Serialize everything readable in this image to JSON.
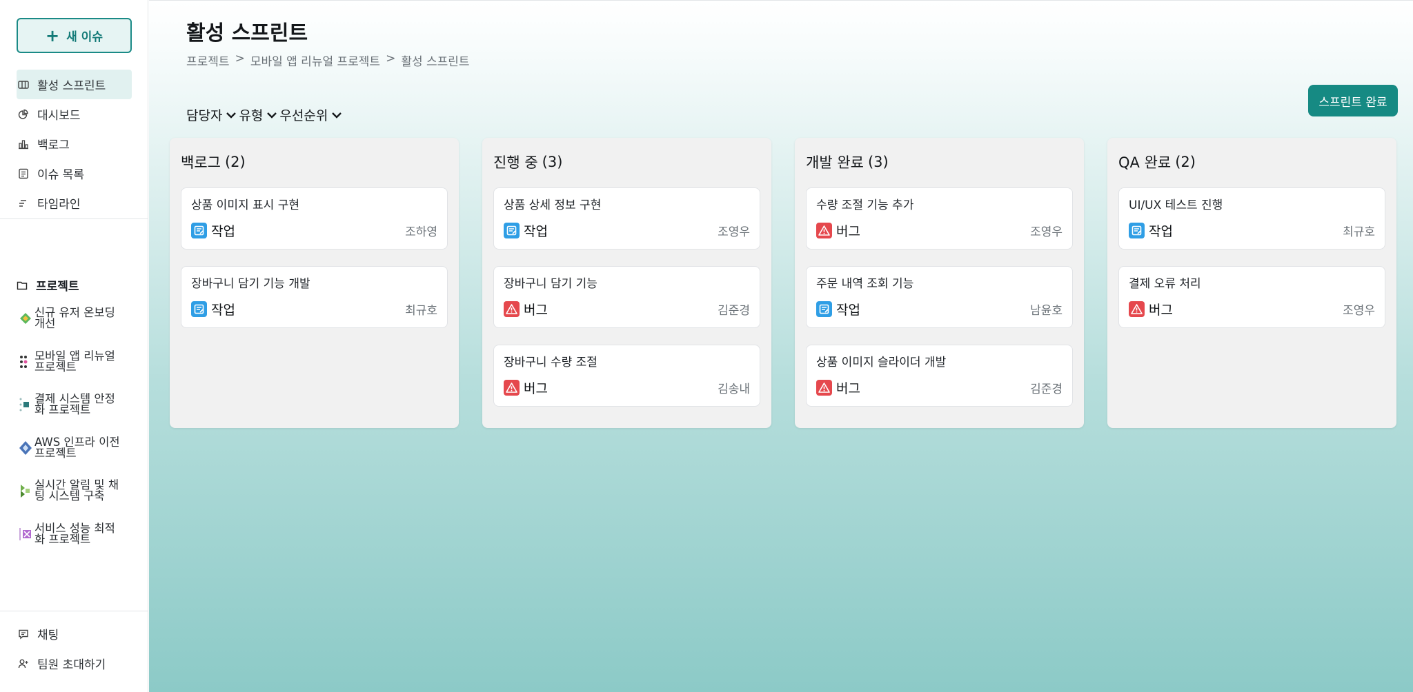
{
  "sidebar": {
    "new_issue_label": "새 이슈",
    "nav": [
      {
        "label": "활성 스프린트",
        "icon": "board-icon",
        "active": true
      },
      {
        "label": "대시보드",
        "icon": "pie-chart-icon"
      },
      {
        "label": "백로그",
        "icon": "bar-chart-icon"
      },
      {
        "label": "이슈 목록",
        "icon": "list-document-icon"
      },
      {
        "label": "타임라인",
        "icon": "timeline-icon"
      }
    ],
    "projects_header": "프로젝트",
    "projects": [
      {
        "line1": "신규 유저 온보딩",
        "line2": "개선"
      },
      {
        "line1": "모바일 앱 리뉴얼",
        "line2": "프로젝트"
      },
      {
        "line1": "결제 시스템 안정",
        "line2": "화 프로젝트"
      },
      {
        "line1": "AWS 인프라 이전",
        "line2": "프로젝트"
      },
      {
        "line1": "실시간 알림 및 채",
        "line2": "팅 시스템 구축"
      },
      {
        "line1": "서비스 성능 최적",
        "line2": "화 프로젝트"
      }
    ],
    "bottom": [
      {
        "label": "채팅"
      },
      {
        "label": "팀원 초대하기"
      }
    ]
  },
  "main": {
    "title": "활성 스프린트",
    "breadcrumb": [
      "프로젝트",
      "모바일 앱 리뉴얼 프로젝트",
      "활성 스프린트"
    ],
    "filters": [
      "담당자",
      "유형",
      "우선순위"
    ],
    "complete_button": "스프린트 완료",
    "columns": [
      {
        "title": "백로그",
        "count": "(2)",
        "cards": [
          {
            "title": "상품 이미지 표시 구현",
            "type": "작업",
            "kind": "task",
            "assignee": "조하영"
          },
          {
            "title": "장바구니 담기 기능 개발",
            "type": "작업",
            "kind": "task",
            "assignee": "최규호"
          }
        ]
      },
      {
        "title": "진행 중",
        "count": "(3)",
        "cards": [
          {
            "title": "상품 상세 정보 구현",
            "type": "작업",
            "kind": "task",
            "assignee": "조영우"
          },
          {
            "title": "장바구니 담기 기능",
            "type": "버그",
            "kind": "bug",
            "assignee": "김준경"
          },
          {
            "title": "장바구니 수량 조절",
            "type": "버그",
            "kind": "bug",
            "assignee": "김송내"
          }
        ]
      },
      {
        "title": "개발 완료",
        "count": "(3)",
        "cards": [
          {
            "title": "수량 조절 기능 추가",
            "type": "버그",
            "kind": "bug",
            "assignee": "조영우"
          },
          {
            "title": "주문 내역 조회 기능",
            "type": "작업",
            "kind": "task",
            "assignee": "남윤호"
          },
          {
            "title": "상품 이미지 슬라이더 개발",
            "type": "버그",
            "kind": "bug",
            "assignee": "김준경"
          }
        ]
      },
      {
        "title": "QA 완료",
        "count": "(2)",
        "cards": [
          {
            "title": "UI/UX 테스트 진행",
            "type": "작업",
            "kind": "task",
            "assignee": "최규호"
          },
          {
            "title": "결제 오류 처리",
            "type": "버그",
            "kind": "bug",
            "assignee": "조영우"
          }
        ]
      }
    ]
  },
  "colors": {
    "accent": "#168a83",
    "task": "#2f9ee5",
    "bug": "#e5484d"
  }
}
